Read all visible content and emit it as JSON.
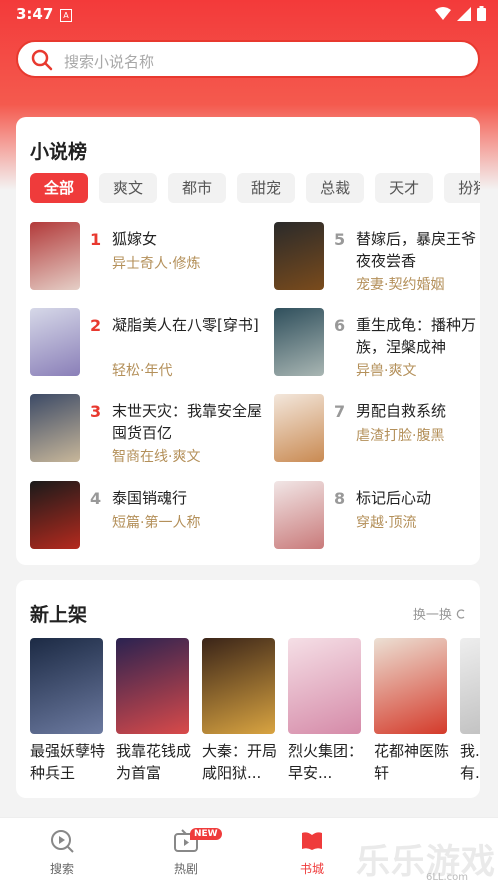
{
  "status": {
    "time": "3:47"
  },
  "search": {
    "placeholder": "搜索小说名称"
  },
  "rank": {
    "title": "小说榜",
    "tabs": [
      "全部",
      "爽文",
      "都市",
      "甜宠",
      "总裁",
      "天才",
      "扮猪吃"
    ],
    "items": [
      {
        "num": "1",
        "name": "狐嫁女",
        "tag": "异士奇人·修炼",
        "color": "#e8392f",
        "cover": [
          "#b23a3a",
          "#e5cfc7"
        ]
      },
      {
        "num": "2",
        "name": "凝脂美人在八零[穿书]",
        "tag": "轻松·年代",
        "color": "#e8392f",
        "cover": [
          "#d6d8e8",
          "#8a7fb8"
        ]
      },
      {
        "num": "3",
        "name": "末世天灾：我靠安全屋囤货百亿",
        "tag": "智商在线·爽文",
        "color": "#e8392f",
        "cover": [
          "#3c4a66",
          "#c8b79a"
        ]
      },
      {
        "num": "4",
        "name": "泰国销魂行",
        "tag": "短篇·第一人称",
        "color": "#999999",
        "cover": [
          "#1a1a1a",
          "#b52a1e"
        ]
      },
      {
        "num": "5",
        "name": "替嫁后，暴戾王爷夜夜尝香",
        "tag": "宠妻·契约婚姻",
        "color": "#999999",
        "cover": [
          "#2a2a2a",
          "#7a4b1c"
        ]
      },
      {
        "num": "6",
        "name": "重生成龟：播种万族，涅槃成神",
        "tag": "异兽·爽文",
        "color": "#999999",
        "cover": [
          "#2f4f5c",
          "#a9b6b3"
        ]
      },
      {
        "num": "7",
        "name": "男配自救系统",
        "tag": "虐渣打脸·腹黑",
        "color": "#999999",
        "cover": [
          "#f3e7dc",
          "#c98a52"
        ]
      },
      {
        "num": "8",
        "name": "标记后心动",
        "tag": "穿越·顶流",
        "color": "#999999",
        "cover": [
          "#f1e6e6",
          "#c97a7a"
        ]
      }
    ]
  },
  "newshelf": {
    "title": "新上架",
    "more": "换一换",
    "books": [
      {
        "title": "最强妖孽特种兵王",
        "cover": [
          "#1c2a44",
          "#6c7aa0"
        ]
      },
      {
        "title": "我靠花钱成为首富",
        "cover": [
          "#2a2250",
          "#d94a4a"
        ]
      },
      {
        "title": "大秦：开局咸阳狱...",
        "cover": [
          "#3a2418",
          "#d9a441"
        ]
      },
      {
        "title": "烈火集团：早安...",
        "cover": [
          "#f5dfe6",
          "#d58aa8"
        ]
      },
      {
        "title": "花都神医陈轩",
        "cover": [
          "#ece0d4",
          "#d43a2a"
        ]
      },
      {
        "title": "我...有...",
        "cover": [
          "#eeeeee",
          "#bbbbbb"
        ]
      }
    ]
  },
  "nav": {
    "search": "搜索",
    "drama": "热剧",
    "badge": "NEW",
    "city": "书城"
  },
  "watermark": {
    "big": "乐乐游戏",
    "small": "6LL.com"
  }
}
